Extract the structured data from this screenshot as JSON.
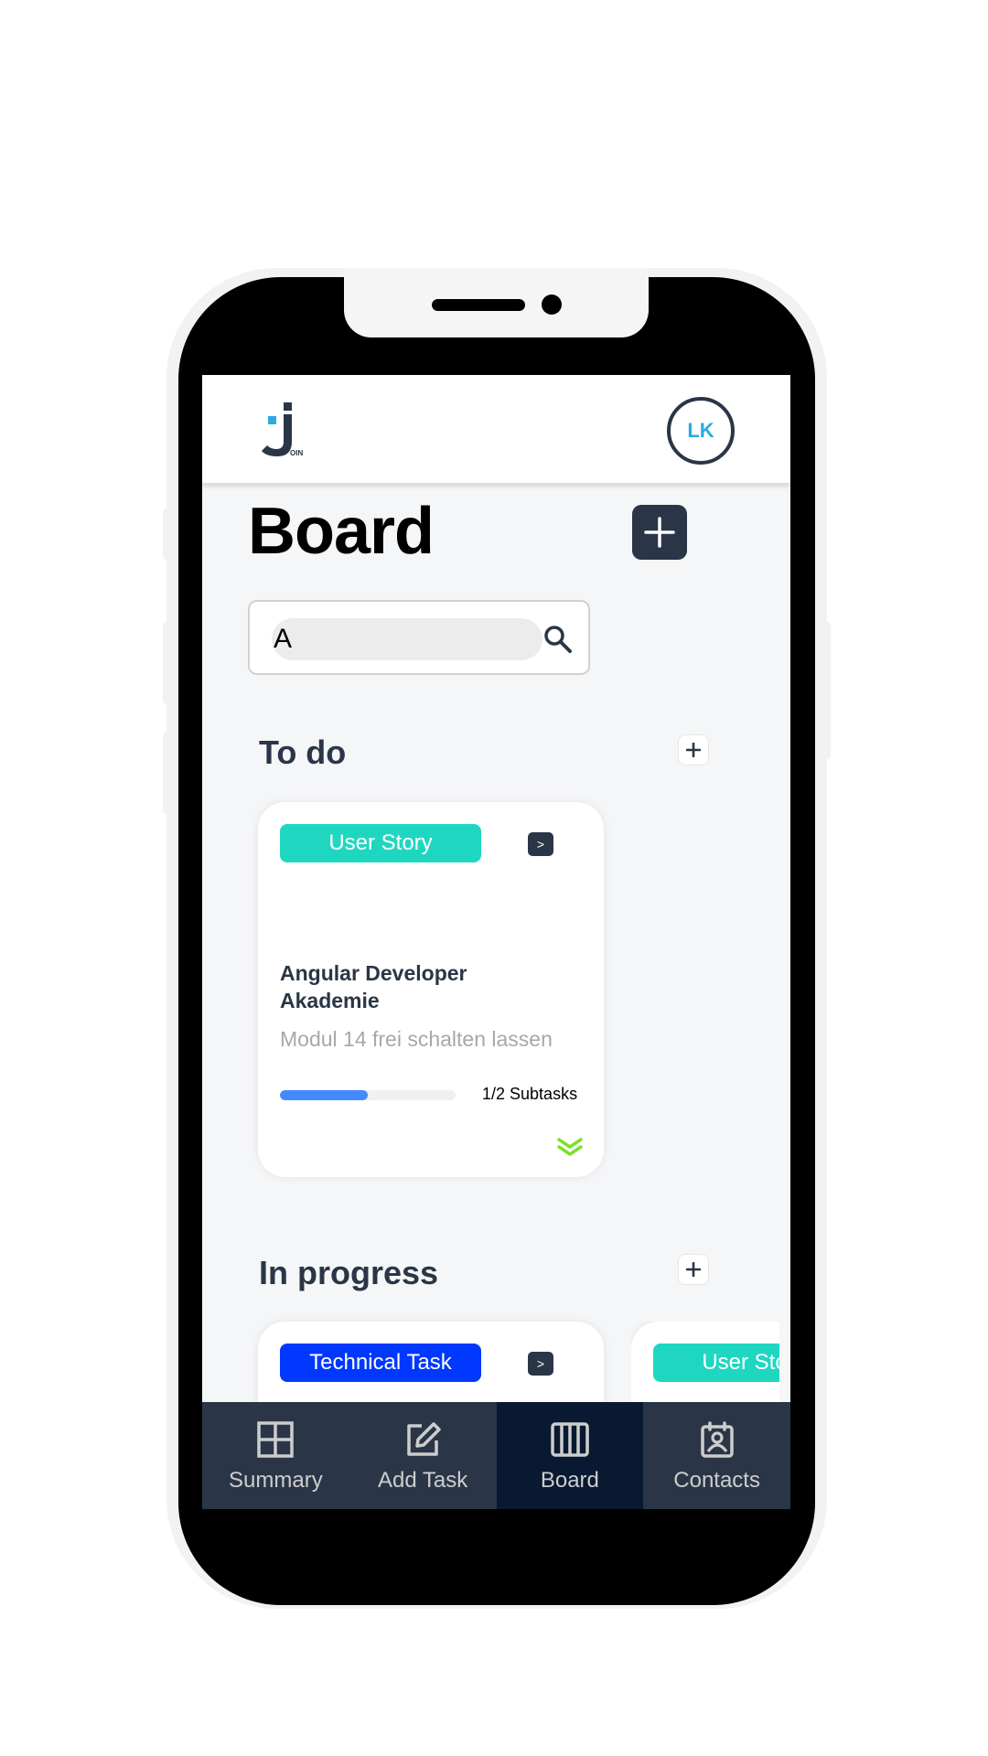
{
  "header": {
    "logo_text": "J",
    "logo_sub": "OIN",
    "avatar_initials": "LK"
  },
  "board": {
    "title": "Board",
    "add_label": "+"
  },
  "search": {
    "value": "A",
    "placeholder": ""
  },
  "columns": [
    {
      "title": "To do",
      "cards": [
        {
          "category": "User Story",
          "category_color": "#1fd7c1",
          "move_label": ">",
          "title": "Angular Developer Akademie",
          "description": "Modul 14 frei schalten lassen",
          "subtasks_text": "1/2 Subtasks",
          "progress": 0.5,
          "priority_icon": "low-priority-chevrons"
        }
      ]
    },
    {
      "title": "In progress",
      "cards": [
        {
          "category": "Technical Task",
          "category_color": "#0038ff",
          "move_label": ">"
        },
        {
          "category": "User Story",
          "category_color": "#1fd7c1"
        }
      ]
    }
  ],
  "nav": {
    "items": [
      {
        "label": "Summary",
        "icon": "summary-icon",
        "active": false
      },
      {
        "label": "Add Task",
        "icon": "add-task-icon",
        "active": false
      },
      {
        "label": "Board",
        "icon": "board-icon",
        "active": true
      },
      {
        "label": "Contacts",
        "icon": "contacts-icon",
        "active": false
      }
    ]
  },
  "colors": {
    "primary_dark": "#2a3647",
    "nav_active": "#091931",
    "accent_blue": "#29abe2",
    "progress_blue": "#4589ff",
    "low_priority_green": "#7ae229"
  }
}
